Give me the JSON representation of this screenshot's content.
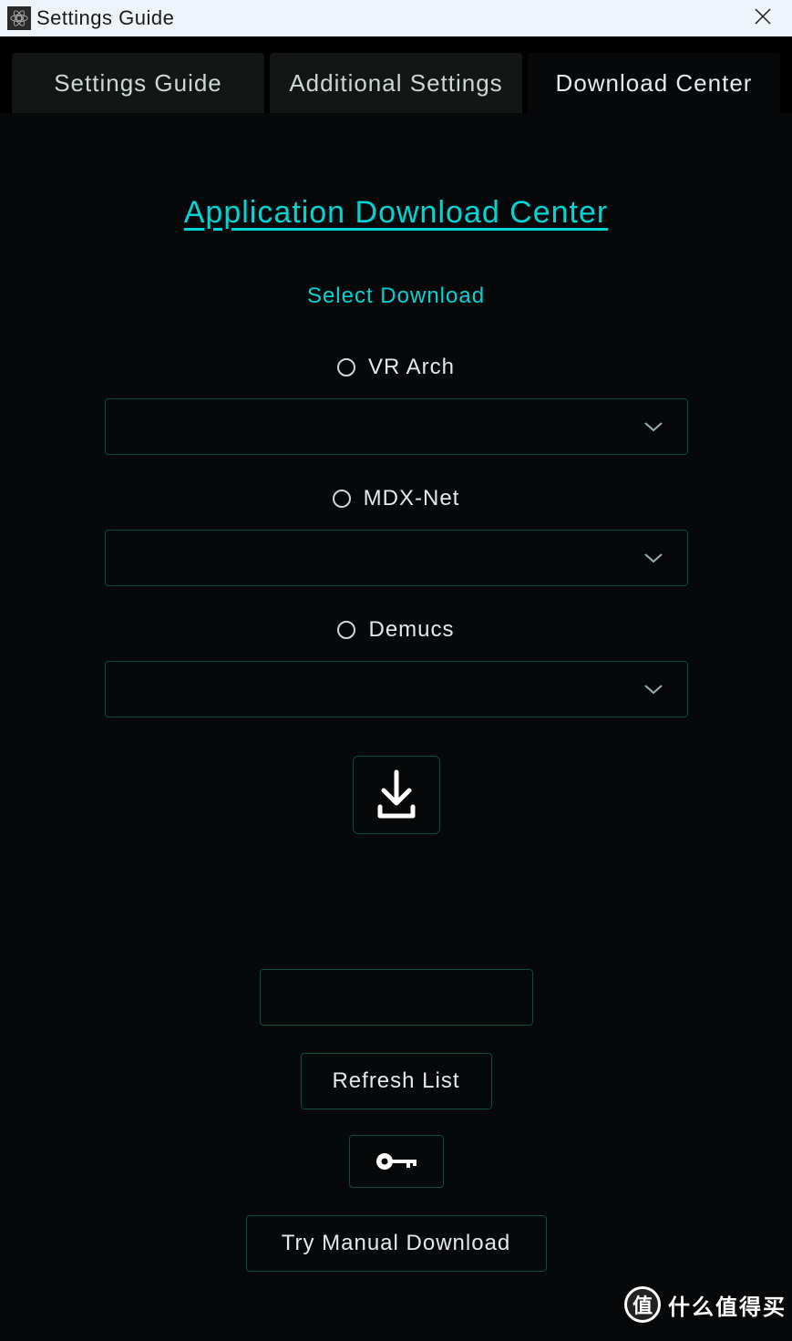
{
  "window": {
    "title": "Settings Guide"
  },
  "tabs": [
    {
      "label": "Settings Guide",
      "active": false
    },
    {
      "label": "Additional Settings",
      "active": false
    },
    {
      "label": "Download Center",
      "active": true
    }
  ],
  "main": {
    "heading": "Application Download Center",
    "subheading": "Select Download",
    "groups": [
      {
        "label": "VR Arch",
        "selected": ""
      },
      {
        "label": "MDX-Net",
        "selected": ""
      },
      {
        "label": "Demucs",
        "selected": ""
      }
    ],
    "refresh_label": "Refresh List",
    "manual_label": "Try Manual Download"
  },
  "watermark": {
    "badge": "值",
    "text": "什么值得买"
  },
  "colors": {
    "accent": "#00d4d4",
    "border": "#0a4b42",
    "bg": "#060809"
  }
}
